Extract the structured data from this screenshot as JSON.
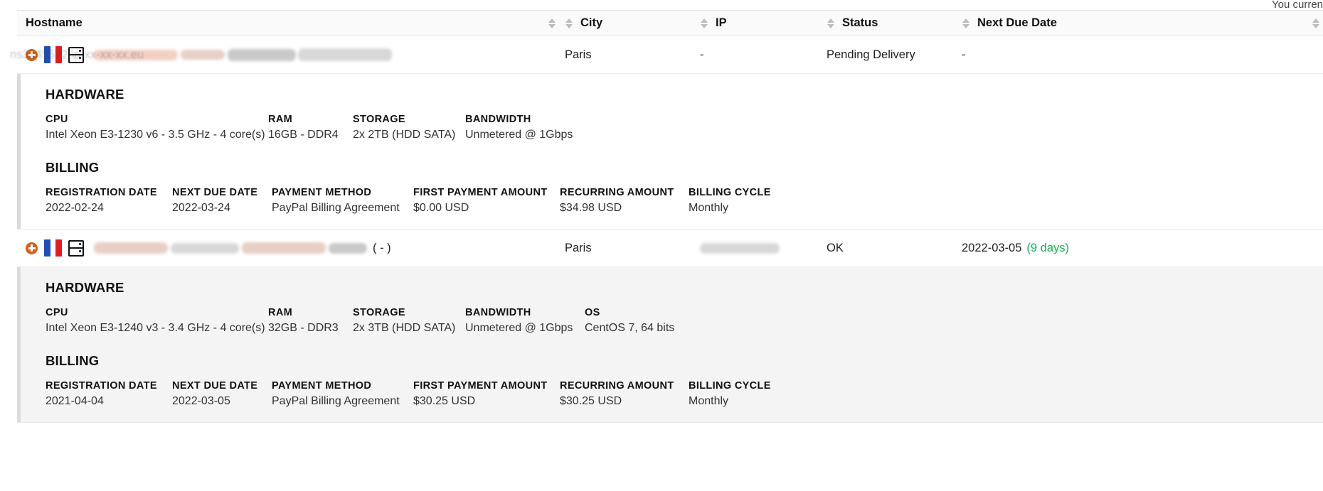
{
  "top_notice": "You curren",
  "table": {
    "columns": [
      {
        "key": "hostname",
        "label": "Hostname",
        "sortable": true
      },
      {
        "key": "city",
        "label": "City",
        "sortable": true
      },
      {
        "key": "ip",
        "label": "IP",
        "sortable": true
      },
      {
        "key": "status",
        "label": "Status",
        "sortable": true
      },
      {
        "key": "next_due_date",
        "label": "Next Due Date",
        "sortable": true
      }
    ],
    "rows": [
      {
        "icons": [
          "expand-icon",
          "flag-france-icon",
          "server-icon"
        ],
        "hostname_redacted": true,
        "hostname_visible_fragment": "ns3145522.ip-xx-xx-xx.eu",
        "city": "Paris",
        "ip": "-",
        "status": "Pending Delivery",
        "next_due_date": "-",
        "next_due_days": "",
        "expanded": true,
        "panel_shade": "white",
        "hardware": {
          "title": "HARDWARE",
          "fields": [
            {
              "label": "CPU",
              "value": "Intel Xeon E3-1230 v6 - 3.5 GHz - 4 core(s)"
            },
            {
              "label": "RAM",
              "value": "16GB - DDR4"
            },
            {
              "label": "STORAGE",
              "value": "2x 2TB (HDD SATA)"
            },
            {
              "label": "BANDWIDTH",
              "value": "Unmetered @ 1Gbps"
            }
          ]
        },
        "billing": {
          "title": "BILLING",
          "fields": [
            {
              "label": "REGISTRATION DATE",
              "value": "2022-02-24"
            },
            {
              "label": "NEXT DUE DATE",
              "value": "2022-03-24"
            },
            {
              "label": "PAYMENT METHOD",
              "value": "PayPal Billing Agreement"
            },
            {
              "label": "FIRST PAYMENT AMOUNT",
              "value": "$0.00 USD"
            },
            {
              "label": "RECURRING AMOUNT",
              "value": "$34.98 USD"
            },
            {
              "label": "BILLING CYCLE",
              "value": "Monthly"
            }
          ]
        }
      },
      {
        "icons": [
          "expand-icon",
          "flag-france-icon",
          "server-icon"
        ],
        "hostname_redacted": true,
        "hostname_visible_fragment": "( - )",
        "city": "Paris",
        "ip": "",
        "status": "OK",
        "next_due_date": "2022-03-05",
        "next_due_days": "(9 days)",
        "expanded": true,
        "panel_shade": "grey",
        "hardware": {
          "title": "HARDWARE",
          "fields": [
            {
              "label": "CPU",
              "value": "Intel Xeon E3-1240 v3 - 3.4 GHz - 4 core(s)"
            },
            {
              "label": "RAM",
              "value": "32GB - DDR3"
            },
            {
              "label": "STORAGE",
              "value": "2x 3TB (HDD SATA)"
            },
            {
              "label": "BANDWIDTH",
              "value": "Unmetered @ 1Gbps"
            },
            {
              "label": "OS",
              "value": "CentOS 7, 64 bits"
            }
          ]
        },
        "billing": {
          "title": "BILLING",
          "fields": [
            {
              "label": "REGISTRATION DATE",
              "value": "2021-04-04"
            },
            {
              "label": "NEXT DUE DATE",
              "value": "2022-03-05"
            },
            {
              "label": "PAYMENT METHOD",
              "value": "PayPal Billing Agreement"
            },
            {
              "label": "FIRST PAYMENT AMOUNT",
              "value": "$30.25 USD"
            },
            {
              "label": "RECURRING AMOUNT",
              "value": "$30.25 USD"
            },
            {
              "label": "BILLING CYCLE",
              "value": "Monthly"
            }
          ]
        }
      }
    ]
  },
  "colors": {
    "accent_orange": "#d2601a",
    "green_days": "#1aab54",
    "header_bg": "#fafafa",
    "panel_grey": "#f4f4f4"
  }
}
